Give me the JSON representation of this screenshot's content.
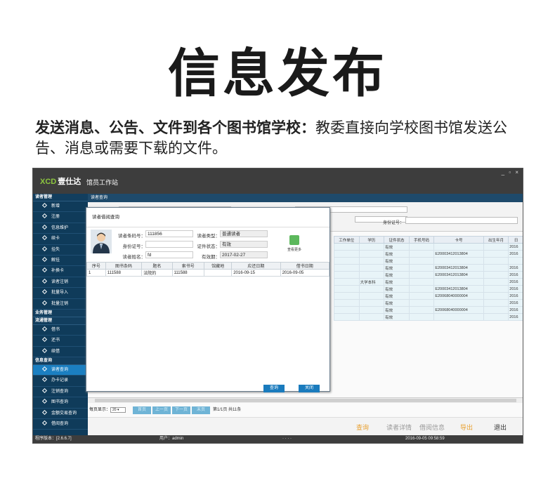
{
  "headline": "信息发布",
  "desc": {
    "bold": "发送消息、公告、文件到各个图书馆学校：",
    "rest": "教委直接向学校图书馆发送公告、消息或需要下载的文件。"
  },
  "app": {
    "logo": "XCD",
    "brand": "壹仕达",
    "station": "馆员工作站",
    "window_controls": "_ ▫ ×"
  },
  "sidebar": {
    "sections": [
      {
        "label": "读者管理",
        "items": [
          "新增",
          "注册",
          "信息维护",
          "续卡",
          "挂失",
          "解挂",
          "补换卡",
          "读者注销",
          "批量导入",
          "批量注销"
        ]
      },
      {
        "label": "业务管理",
        "items": []
      },
      {
        "label": "流通管理",
        "items": [
          "借书",
          "还书",
          "续借"
        ]
      },
      {
        "label": "信息查询",
        "items": [
          "读者查询",
          "办卡记录",
          "注销查询",
          "图书查询",
          "金额交易查询",
          "借阅查询"
        ]
      }
    ],
    "active": "读者查询"
  },
  "content": {
    "title": "读者查询",
    "id_label": "身份证号："
  },
  "grid": {
    "columns": [
      "工作单位",
      "学历",
      "证件状态",
      "手机号码",
      "卡号",
      "出生年月",
      "日"
    ],
    "rows": [
      [
        "",
        "",
        "有效",
        "",
        "",
        "",
        "2016"
      ],
      [
        "",
        "",
        "有效",
        "",
        "E20003412013804",
        "",
        "2016"
      ],
      [
        "",
        "",
        "有效",
        "",
        "",
        "",
        ""
      ],
      [
        "",
        "",
        "有效",
        "",
        "E20003412013804",
        "",
        "2016"
      ],
      [
        "",
        "",
        "有效",
        "",
        "E20003412013804",
        "",
        "2016"
      ],
      [
        "",
        "大学本科",
        "有效",
        "",
        "",
        "",
        "2016"
      ],
      [
        "",
        "",
        "有效",
        "",
        "E20003412013804",
        "",
        "2016"
      ],
      [
        "",
        "",
        "有效",
        "",
        "E20068040000004",
        "",
        "2016"
      ],
      [
        "",
        "",
        "有效",
        "",
        "",
        "",
        "2016"
      ],
      [
        "",
        "",
        "有效",
        "",
        "E20068040000004",
        "",
        "2016"
      ],
      [
        "",
        "",
        "有效",
        "",
        "",
        "",
        "2016"
      ]
    ]
  },
  "pager": {
    "size_label": "每页显示：",
    "size": "20",
    "first": "首页",
    "prev": "上一页",
    "next": "下一页",
    "last": "末页",
    "info": "第1/1页 共11条"
  },
  "actions": {
    "query": "查询",
    "reader_detail": "读者详情",
    "borrow_info": "借阅信息",
    "export": "导出",
    "exit": "退出"
  },
  "status": {
    "version": "程序版本：[2.6.6.7]",
    "user": "用户：admin",
    "dots": "·  ·  ·  ·",
    "datetime": "2016-09-05 09:58:59"
  },
  "dialog": {
    "title": "读者借阅查询",
    "barcode_label": "读者条码号：",
    "barcode": "111856",
    "type_label": "读者类型：",
    "type": "普通读者",
    "id_label": "身份证号：",
    "id": "",
    "cert_status_label": "证件状态：",
    "cert_status": "有效",
    "name_label": "读者姓名：",
    "name": "fd",
    "expiry_label": "有效期：",
    "expiry": "2017-02-27",
    "more_label": "查看更多",
    "columns": [
      "序号",
      "图书条码",
      "题名",
      "索书号",
      "馆藏地",
      "应还日期",
      "借书日期"
    ],
    "rows": [
      [
        "1",
        "111588",
        "法院的",
        "111588",
        "",
        "2016-09-15",
        "2016-09-05"
      ]
    ],
    "btn_query": "查询",
    "btn_close": "关闭"
  }
}
